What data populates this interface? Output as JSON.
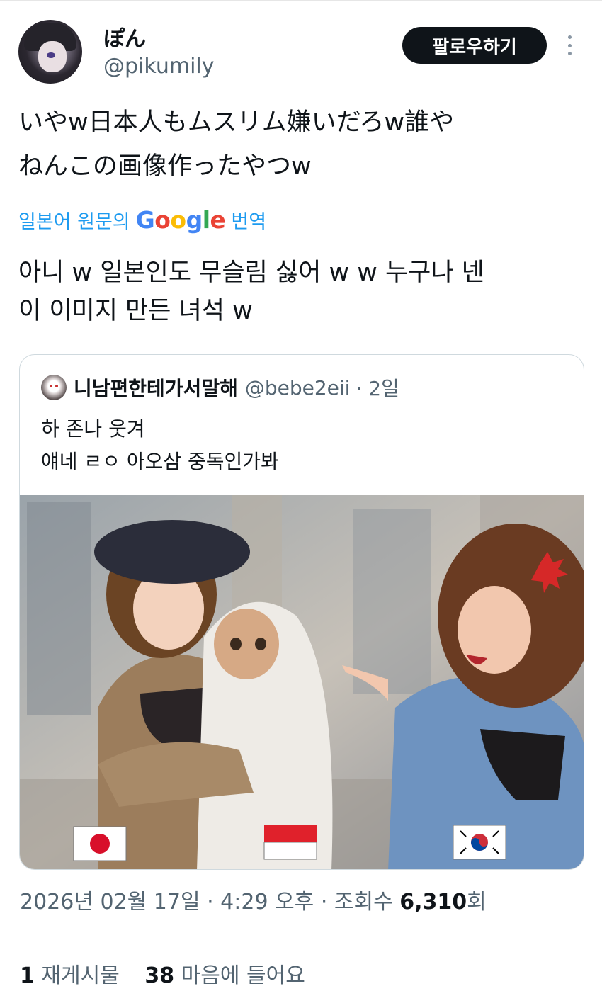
{
  "author": {
    "display_name": "ぽん",
    "handle": "@pikumily"
  },
  "actions": {
    "follow_label": "팔로우하기"
  },
  "post": {
    "text_line1": "いやw日本人もムスリム嫌いだろw誰や",
    "text_line2": "ねんこの画像作ったやつw"
  },
  "translation": {
    "prefix": "일본어 원문의",
    "google_g": "G",
    "google_o1": "o",
    "google_o2": "o",
    "google_g2": "g",
    "google_l": "l",
    "google_e": "e",
    "suffix": "번역",
    "text_line1": "아니 w 일본인도 무슬림 싫어 w w 누구나 넨",
    "text_line2": "이 이미지 만든 녀석 w"
  },
  "quoted": {
    "display_name": "니남편한테가서말해",
    "handle": "@bebe2eii",
    "time": "· 2일",
    "text_line1": "하 존나 웃겨",
    "text_line2": "얘네 ㄹㅇ 아오삼 중독인가봐"
  },
  "meta": {
    "date": "2026년 02월 17일 · 4:29 오후 · 조회수",
    "views": "6,310",
    "views_unit": "회"
  },
  "stats": {
    "reposts_count": "1",
    "reposts_label": "재게시물",
    "likes_count": "38",
    "likes_label": "마음에 들어요"
  },
  "colors": {
    "accent": "#1d9bf0",
    "text": "#0f1419",
    "muted": "#536471",
    "button_bg": "#0f1419"
  }
}
